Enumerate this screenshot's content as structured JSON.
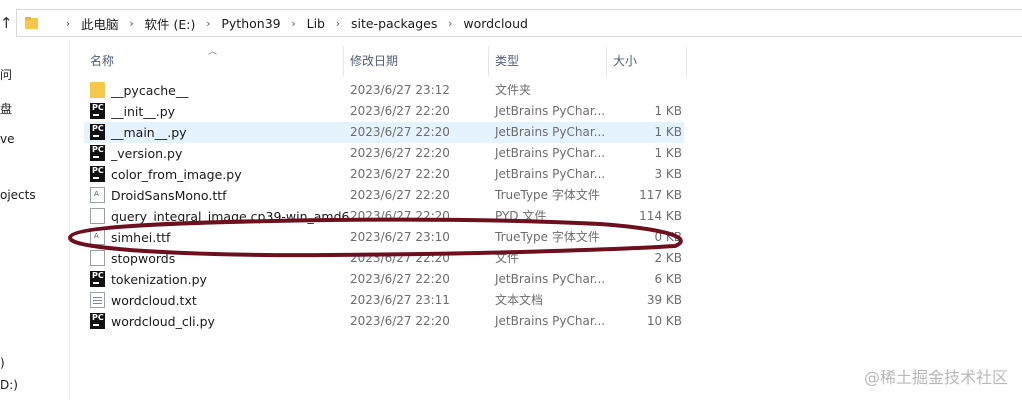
{
  "address_bar": {
    "crumbs": [
      "此电脑",
      "软件 (E:)",
      "Python39",
      "Lib",
      "site-packages",
      "wordcloud"
    ]
  },
  "nav_pane": {
    "fragments": [
      "问",
      "盘",
      "ve",
      "ojects",
      ")",
      "D:)"
    ]
  },
  "columns": {
    "name": "名称",
    "date": "修改日期",
    "type": "类型",
    "size": "大小"
  },
  "files": [
    {
      "name": "__pycache__",
      "date": "2023/6/27 23:12",
      "type": "文件夹",
      "size": "",
      "icon": "folder-icon"
    },
    {
      "name": "__init__.py",
      "date": "2023/6/27 22:20",
      "type": "JetBrains PyChar...",
      "size": "1 KB",
      "icon": "pycharm-file-icon"
    },
    {
      "name": "__main__.py",
      "date": "2023/6/27 22:20",
      "type": "JetBrains PyChar...",
      "size": "1 KB",
      "icon": "pycharm-file-icon"
    },
    {
      "name": "_version.py",
      "date": "2023/6/27 22:20",
      "type": "JetBrains PyChar...",
      "size": "1 KB",
      "icon": "pycharm-file-icon"
    },
    {
      "name": "color_from_image.py",
      "date": "2023/6/27 22:20",
      "type": "JetBrains PyChar...",
      "size": "3 KB",
      "icon": "pycharm-file-icon"
    },
    {
      "name": "DroidSansMono.ttf",
      "date": "2023/6/27 22:20",
      "type": "TrueType 字体文件",
      "size": "117 KB",
      "icon": "font-file-icon"
    },
    {
      "name": "query_integral_image.cp39-win_amd6",
      "date": "2023/6/27 22:20",
      "type": "PYD 文件",
      "size": "114 KB",
      "icon": "generic-file-icon"
    },
    {
      "name": "simhei.ttf",
      "date": "2023/6/27 23:10",
      "type": "TrueType 字体文件",
      "size": "0 KB",
      "icon": "font-file-icon"
    },
    {
      "name": "stopwords",
      "date": "2023/6/27 22:20",
      "type": "文件",
      "size": "2 KB",
      "icon": "generic-file-icon"
    },
    {
      "name": "tokenization.py",
      "date": "2023/6/27 22:20",
      "type": "JetBrains PyChar...",
      "size": "6 KB",
      "icon": "pycharm-file-icon"
    },
    {
      "name": "wordcloud.txt",
      "date": "2023/6/27 23:11",
      "type": "文本文档",
      "size": "39 KB",
      "icon": "text-file-icon"
    },
    {
      "name": "wordcloud_cli.py",
      "date": "2023/6/27 22:20",
      "type": "JetBrains PyChar...",
      "size": "10 KB",
      "icon": "pycharm-file-icon"
    }
  ],
  "highlighted_row": "__main__.py",
  "annotation_circled_row": "simhei.ttf",
  "annotation_color": "#6e0f1e",
  "watermark": "@稀土掘金技术社区"
}
